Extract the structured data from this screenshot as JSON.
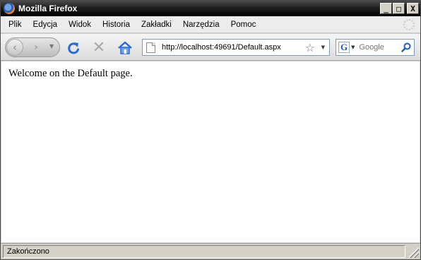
{
  "window": {
    "title": "Mozilla Firefox",
    "controls": {
      "minimize": "_",
      "maximize": "□",
      "close": "X"
    }
  },
  "menu": {
    "items": [
      {
        "label": "Plik"
      },
      {
        "label": "Edycja"
      },
      {
        "label": "Widok"
      },
      {
        "label": "Historia"
      },
      {
        "label": "Zakładki"
      },
      {
        "label": "Narzędzia"
      },
      {
        "label": "Pomoc"
      }
    ]
  },
  "navigation": {
    "back_icon": "back-arrow-icon",
    "forward_icon": "forward-arrow-icon",
    "reload_icon": "reload-icon",
    "stop_icon": "stop-icon",
    "home_icon": "home-icon",
    "url": "http://localhost:49691/Default.aspx",
    "bookmark_icon": "star-icon"
  },
  "search": {
    "engine_letter": "G",
    "placeholder": "Google"
  },
  "page": {
    "text": "Welcome on the Default page."
  },
  "status": {
    "text": "Zakończono"
  },
  "colors": {
    "titlebar": "#000000",
    "chrome": "#d4d0c8",
    "url_border": "#7f9db9"
  }
}
